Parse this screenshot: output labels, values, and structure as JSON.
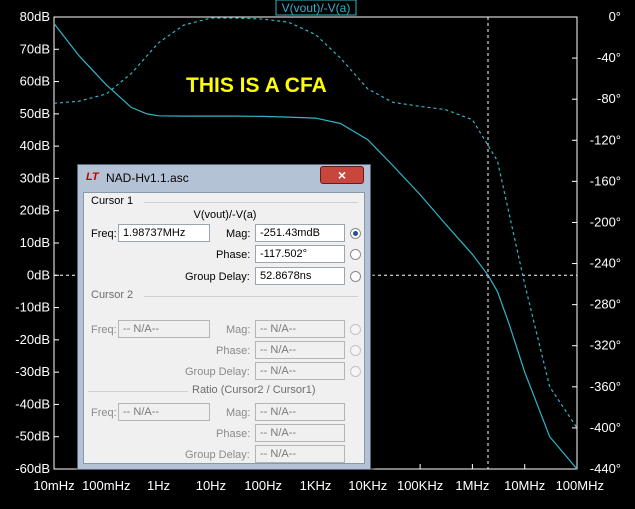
{
  "plot": {
    "trace_title": "V(vout)/-V(a)",
    "annotation": "THIS IS A CFA",
    "colors": {
      "background": "#000000",
      "trace": "#33b4c8",
      "grid": "#ffffff",
      "annotation": "#ffff00"
    }
  },
  "chart_data": {
    "type": "line",
    "title": "V(vout)/-V(a)",
    "x_scale": "log",
    "xlim_hz": [
      0.01,
      100000000
    ],
    "x_ticks": [
      "10mHz",
      "100mHz",
      "1Hz",
      "10Hz",
      "100Hz",
      "1KHz",
      "10KHz",
      "100KHz",
      "1MHz",
      "10MHz",
      "100MHz"
    ],
    "y_left_ticks": [
      "80dB",
      "70dB",
      "60dB",
      "50dB",
      "40dB",
      "30dB",
      "20dB",
      "10dB",
      "0dB",
      "-10dB",
      "-20dB",
      "-30dB",
      "-40dB",
      "-50dB",
      "-60dB"
    ],
    "y_left_range_db": [
      -60,
      80
    ],
    "y_right_ticks": [
      "0°",
      "-40°",
      "-80°",
      "-120°",
      "-160°",
      "-200°",
      "-240°",
      "-280°",
      "-320°",
      "-360°",
      "-400°",
      "-440°"
    ],
    "y_right_range_deg": [
      -440,
      0
    ],
    "series": [
      {
        "kind": "magnitude",
        "style": "solid",
        "x": [
          0.01,
          0.03,
          0.1,
          0.3,
          0.6,
          1,
          3,
          10,
          30,
          100,
          300,
          1000,
          3000,
          10000,
          30000,
          100000,
          300000,
          1000000,
          2000000,
          3000000,
          5000000,
          10000000,
          30000000,
          100000000
        ],
        "y": [
          78,
          68,
          59,
          52,
          50,
          49.4,
          49.3,
          49.3,
          49.3,
          49.2,
          49,
          48.7,
          47,
          42,
          34,
          25,
          16,
          6.5,
          0,
          -5,
          -15,
          -30,
          -50,
          -60
        ]
      },
      {
        "kind": "phase",
        "style": "dashed",
        "x": [
          0.01,
          0.03,
          0.1,
          0.3,
          1,
          3,
          10,
          30,
          100,
          300,
          1000,
          3000,
          10000,
          30000,
          100000,
          300000,
          1000000,
          3000000,
          10000000,
          30000000,
          100000000
        ],
        "y": [
          -84,
          -82,
          -75,
          -55,
          -25,
          -8,
          -1,
          -1,
          -2,
          -5,
          -17,
          -40,
          -70,
          -83,
          -87,
          -90,
          -100,
          -140,
          -260,
          -360,
          -400
        ]
      }
    ],
    "cursor_freq_hz": 1987370
  },
  "dialog": {
    "logo": "LT",
    "title": "NAD-Hv1.1.asc",
    "close_label": "×",
    "cursor1": {
      "heading": "Cursor 1",
      "expression": "V(vout)/-V(a)",
      "freq_label": "Freq:",
      "freq_value": "1.98737MHz",
      "mag_label": "Mag:",
      "mag_value": "-251.43mdB",
      "phase_label": "Phase:",
      "phase_value": "-117.502°",
      "gd_label": "Group Delay:",
      "gd_value": "52.8678ns"
    },
    "cursor2": {
      "heading": "Cursor 2",
      "freq_label": "Freq:",
      "freq_value": "-- N/A--",
      "mag_label": "Mag:",
      "mag_value": "-- N/A--",
      "phase_label": "Phase:",
      "phase_value": "-- N/A--",
      "gd_label": "Group Delay:",
      "gd_value": "-- N/A--"
    },
    "ratio": {
      "heading": "Ratio (Cursor2 / Cursor1)",
      "freq_label": "Freq:",
      "freq_value": "-- N/A--",
      "mag_label": "Mag:",
      "mag_value": "-- N/A--",
      "phase_label": "Phase:",
      "phase_value": "-- N/A--",
      "gd_label": "Group Delay:",
      "gd_value": "-- N/A--"
    }
  }
}
